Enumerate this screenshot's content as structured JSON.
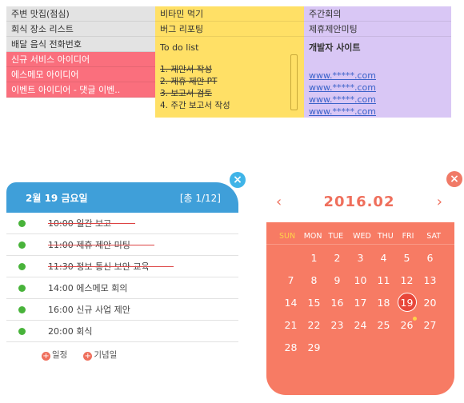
{
  "memo": {
    "gray": [
      "주변 맛집(점심)",
      "회식 장소 리스트",
      "배달 음식 전화번호"
    ],
    "pink": [
      "신규 서비스 아이디어",
      "에스메모 아이디어",
      "이벤트 아이디어 - 댓글 이벤.."
    ],
    "yellow": [
      "비타민 먹기",
      "버그 리포팅"
    ],
    "todo_title": "To do list",
    "todo_items": [
      "1. 제안서 작성",
      "2. 제휴 제안 PT",
      "3. 보고서 검토",
      "4. 주간 보고서 작성"
    ],
    "purple": [
      "주간회의",
      "제휴제안미팅"
    ],
    "dev_title": "개발자 사이트",
    "links": [
      "www.*****.com",
      "www.*****.com",
      "www.*****.com",
      "www.*****.com"
    ]
  },
  "schedule": {
    "date": "2월 19 금요일",
    "page": "[총 1/12]",
    "close": "×",
    "items": [
      {
        "time": "10:00",
        "title": "일간 보고"
      },
      {
        "time": "11:00",
        "title": "제휴 제안 미팅"
      },
      {
        "time": "11:30",
        "title": "정보 통신 보안 교육"
      },
      {
        "time": "14:00",
        "title": "에스메모 회의"
      },
      {
        "time": "16:00",
        "title": "신규 사업 제안"
      },
      {
        "time": "20:00",
        "title": "회식"
      }
    ],
    "btn_event": "일정",
    "btn_anniv": "기념일",
    "plus": "+"
  },
  "calendar": {
    "month": "2016.02",
    "prev": "‹",
    "next": "›",
    "close": "×",
    "dow": [
      "SUN",
      "MON",
      "TUE",
      "WED",
      "THU",
      "FRI",
      "SAT"
    ],
    "days": [
      "",
      "1",
      "2",
      "3",
      "4",
      "5",
      "6",
      "7",
      "8",
      "9",
      "10",
      "11",
      "12",
      "13",
      "14",
      "15",
      "16",
      "17",
      "18",
      "19",
      "20",
      "21",
      "22",
      "23",
      "24",
      "25",
      "26",
      "27",
      "28",
      "29"
    ],
    "today": "19",
    "marked": "26",
    "accent": "#f77b64"
  }
}
